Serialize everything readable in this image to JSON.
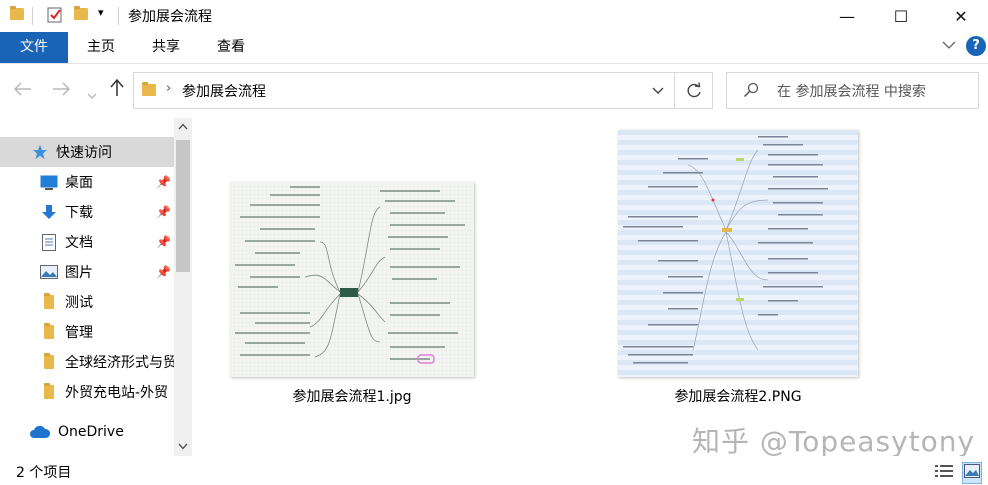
{
  "window": {
    "title": "参加展会流程",
    "minimize_glyph": "—",
    "maximize_glyph": "☐",
    "close_glyph": "✕"
  },
  "ribbon": {
    "tabs": [
      {
        "label": "文件"
      },
      {
        "label": "主页"
      },
      {
        "label": "共享"
      },
      {
        "label": "查看"
      }
    ],
    "help_glyph": "?"
  },
  "address": {
    "path": "参加展会流程",
    "search_placeholder": "在 参加展会流程 中搜索"
  },
  "sidebar": {
    "items": [
      {
        "label": "快速访问",
        "icon": "star-icon"
      },
      {
        "label": "桌面",
        "icon": "desktop-icon",
        "pinned": true
      },
      {
        "label": "下载",
        "icon": "download-icon",
        "pinned": true
      },
      {
        "label": "文档",
        "icon": "document-icon",
        "pinned": true
      },
      {
        "label": "图片",
        "icon": "picture-icon",
        "pinned": true
      },
      {
        "label": "测试",
        "icon": "folder-icon"
      },
      {
        "label": "管理",
        "icon": "folder-icon"
      },
      {
        "label": "全球经济形式与贸",
        "icon": "folder-icon"
      },
      {
        "label": "外贸充电站-外贸",
        "icon": "folder-icon"
      },
      {
        "label": "OneDrive",
        "icon": "cloud-icon"
      }
    ]
  },
  "files": [
    {
      "name": "参加展会流程1.jpg"
    },
    {
      "name": "参加展会流程2.PNG"
    }
  ],
  "status": {
    "count": "2 个项目"
  },
  "watermark": "知乎 @Topeasytony",
  "colors": {
    "accent": "#1a64b8",
    "selected": "#d9d9d9",
    "folder": "#e8b94a"
  }
}
